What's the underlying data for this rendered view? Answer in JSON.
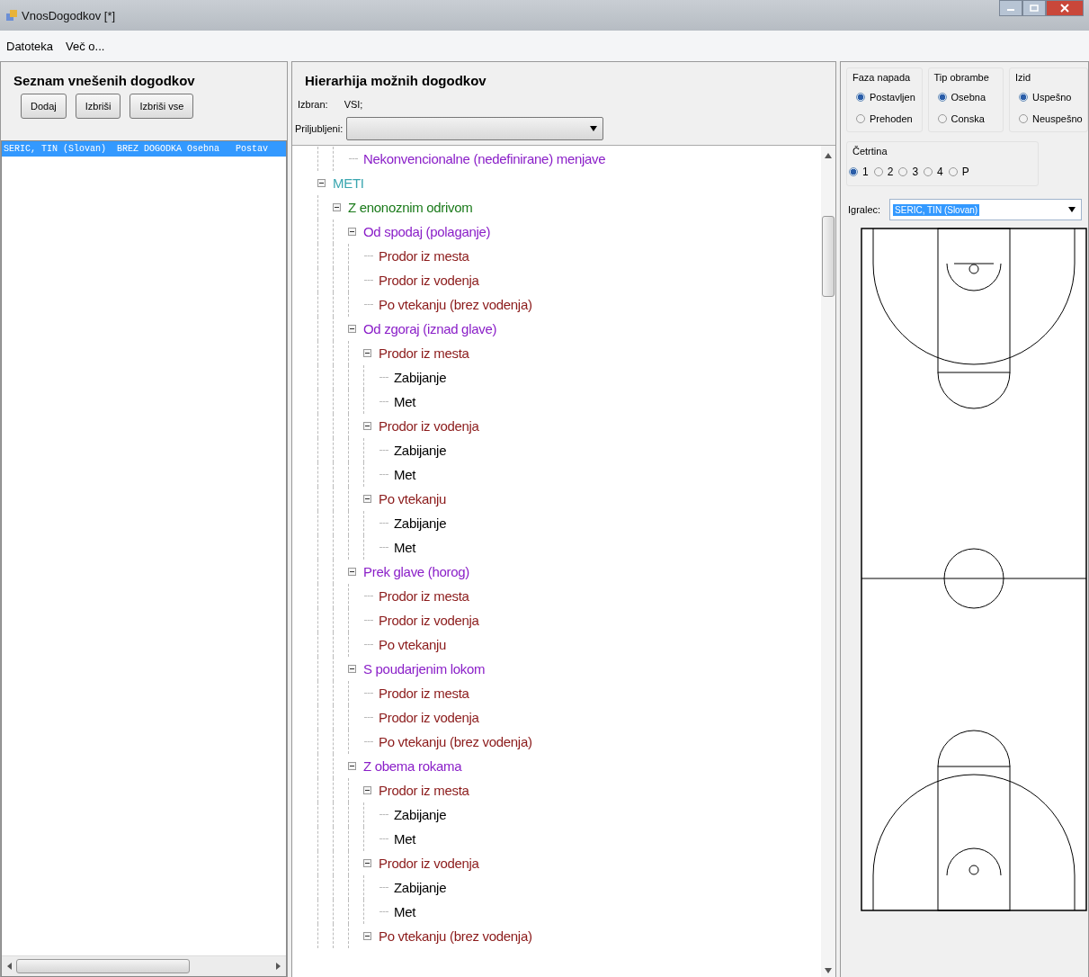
{
  "window": {
    "title": "VnosDogodkov [*]"
  },
  "menu": [
    "Datoteka",
    "Več o..."
  ],
  "events_panel": {
    "title": "Seznam vnešenih dogodkov",
    "buttons": [
      "Dodaj",
      "Izbriši",
      "Izbriši vse"
    ],
    "rows": [
      {
        "text": "SERIC, TIN (Slovan)  BREZ DOGODKA Osebna   Postav",
        "selected": true
      }
    ]
  },
  "hierarchy_panel": {
    "title": "Hierarhija možnih dogodkov",
    "selected_label": "Izbran:",
    "selected_value": "VSI;",
    "favorites_label": "Priljubljeni:",
    "tree": {
      "continued": [
        {
          "label": "Nekonvencionalne (nedefinirane) menjave",
          "color": "#8a1ec8"
        }
      ],
      "items": [
        {
          "label": "METI",
          "color": "#3aa6b0",
          "expanded": true,
          "children": [
            {
              "label": "Z enonoznim odrivom",
              "color": "#1a7a1a",
              "expanded": true,
              "children": [
                {
                  "label": "Od spodaj (polaganje)",
                  "color": "#8a1ec8",
                  "expanded": true,
                  "children": [
                    {
                      "label": "Prodor iz mesta",
                      "color": "#8b1a1a"
                    },
                    {
                      "label": "Prodor iz vodenja",
                      "color": "#8b1a1a"
                    },
                    {
                      "label": "Po vtekanju (brez vodenja)",
                      "color": "#8b1a1a"
                    }
                  ]
                },
                {
                  "label": "Od zgoraj (iznad glave)",
                  "color": "#8a1ec8",
                  "expanded": true,
                  "children": [
                    {
                      "label": "Prodor iz mesta",
                      "color": "#8b1a1a",
                      "expanded": true,
                      "children": [
                        {
                          "label": "Zabijanje",
                          "color": "#000000"
                        },
                        {
                          "label": "Met",
                          "color": "#000000"
                        }
                      ]
                    },
                    {
                      "label": "Prodor iz vodenja",
                      "color": "#8b1a1a",
                      "expanded": true,
                      "children": [
                        {
                          "label": "Zabijanje",
                          "color": "#000000"
                        },
                        {
                          "label": "Met",
                          "color": "#000000"
                        }
                      ]
                    },
                    {
                      "label": "Po vtekanju",
                      "color": "#8b1a1a",
                      "expanded": true,
                      "children": [
                        {
                          "label": "Zabijanje",
                          "color": "#000000"
                        },
                        {
                          "label": "Met",
                          "color": "#000000"
                        }
                      ]
                    }
                  ]
                },
                {
                  "label": "Prek glave (horog)",
                  "color": "#8a1ec8",
                  "expanded": true,
                  "children": [
                    {
                      "label": "Prodor iz mesta",
                      "color": "#8b1a1a"
                    },
                    {
                      "label": "Prodor iz vodenja",
                      "color": "#8b1a1a"
                    },
                    {
                      "label": "Po vtekanju",
                      "color": "#8b1a1a"
                    }
                  ]
                },
                {
                  "label": "S poudarjenim lokom",
                  "color": "#8a1ec8",
                  "expanded": true,
                  "children": [
                    {
                      "label": "Prodor iz mesta",
                      "color": "#8b1a1a"
                    },
                    {
                      "label": "Prodor iz vodenja",
                      "color": "#8b1a1a"
                    },
                    {
                      "label": "Po vtekanju (brez vodenja)",
                      "color": "#8b1a1a"
                    }
                  ]
                },
                {
                  "label": "Z obema rokama",
                  "color": "#8a1ec8",
                  "expanded": true,
                  "children": [
                    {
                      "label": "Prodor iz mesta",
                      "color": "#8b1a1a",
                      "expanded": true,
                      "children": [
                        {
                          "label": "Zabijanje",
                          "color": "#000000"
                        },
                        {
                          "label": "Met",
                          "color": "#000000"
                        }
                      ]
                    },
                    {
                      "label": "Prodor iz vodenja",
                      "color": "#8b1a1a",
                      "expanded": true,
                      "children": [
                        {
                          "label": "Zabijanje",
                          "color": "#000000"
                        },
                        {
                          "label": "Met",
                          "color": "#000000"
                        }
                      ]
                    },
                    {
                      "label": "Po vtekanju (brez vodenja)",
                      "color": "#8b1a1a",
                      "expanded": true
                    }
                  ]
                }
              ]
            }
          ]
        }
      ]
    }
  },
  "options_panel": {
    "groups": [
      {
        "title": "Faza napada",
        "options": [
          {
            "label": "Postavljen",
            "selected": true
          },
          {
            "label": "Prehoden",
            "selected": false
          }
        ]
      },
      {
        "title": "Tip obrambe",
        "options": [
          {
            "label": "Osebna",
            "selected": true
          },
          {
            "label": "Conska",
            "selected": false
          }
        ]
      },
      {
        "title": "Izid",
        "options": [
          {
            "label": "Uspešno",
            "selected": true
          },
          {
            "label": "Neuspešno",
            "selected": false
          }
        ]
      }
    ],
    "quarter": {
      "title": "Četrtina",
      "options": [
        {
          "label": "1",
          "selected": true
        },
        {
          "label": "2",
          "selected": false
        },
        {
          "label": "3",
          "selected": false
        },
        {
          "label": "4",
          "selected": false
        },
        {
          "label": "P",
          "selected": false
        }
      ]
    },
    "player": {
      "label": "Igralec:",
      "value": "SERIC, TIN (Slovan)"
    }
  }
}
